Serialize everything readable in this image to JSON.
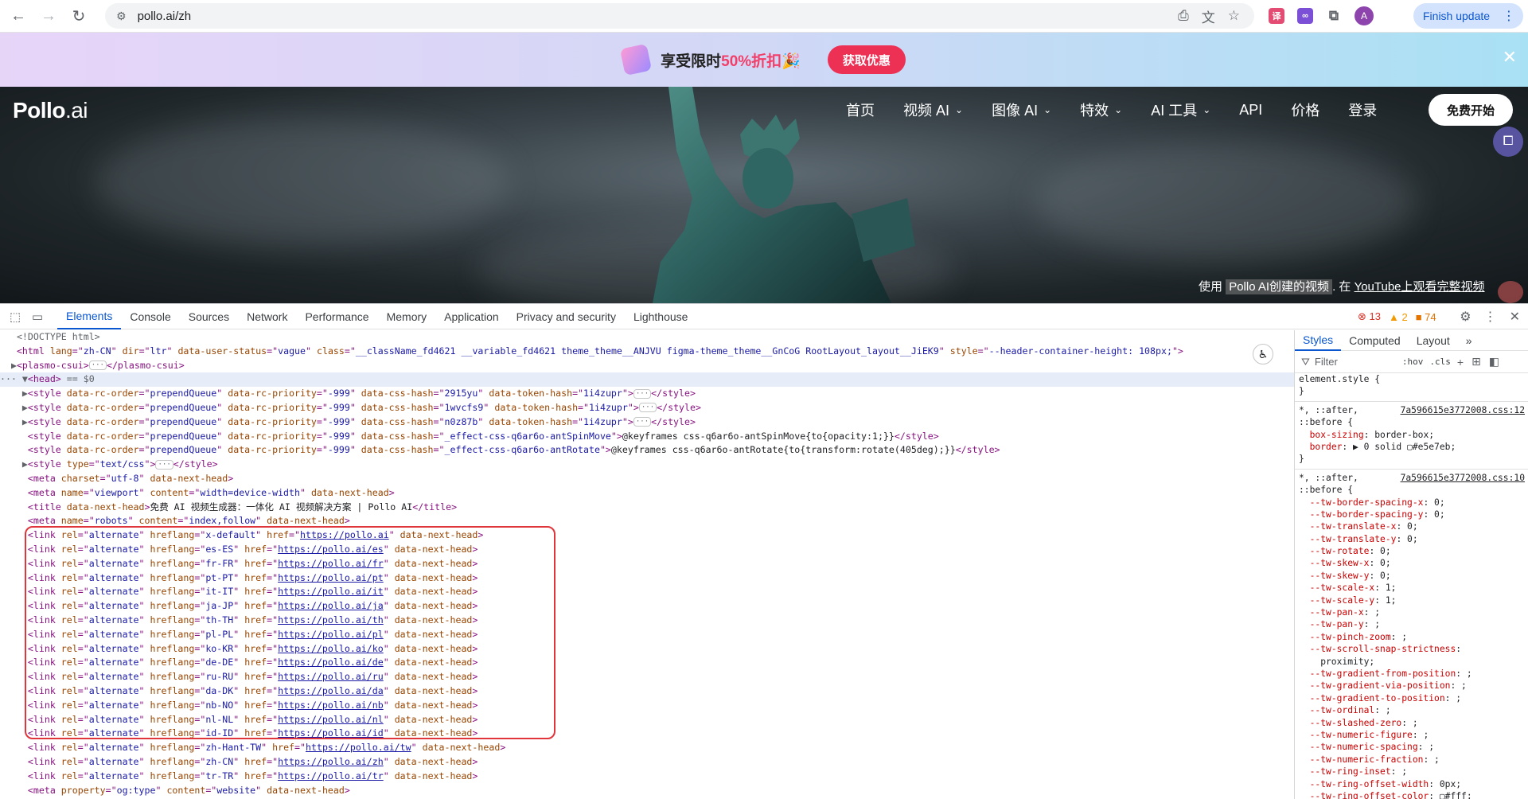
{
  "browser": {
    "url": "pollo.ai/zh",
    "finish_update": "Finish update",
    "avatar_letter": "A"
  },
  "promo": {
    "text_before": "享受限时",
    "text_pct": "50%折扣",
    "text_emoji": "🎉",
    "button": "获取优惠",
    "close": "✕"
  },
  "site": {
    "logo_main": "Pollo",
    "logo_suffix": ".ai",
    "nav": [
      {
        "label": "首页",
        "has_dropdown": false
      },
      {
        "label": "视频 AI",
        "has_dropdown": true
      },
      {
        "label": "图像 AI",
        "has_dropdown": true
      },
      {
        "label": "特效",
        "has_dropdown": true
      },
      {
        "label": "AI 工具",
        "has_dropdown": true
      },
      {
        "label": "API",
        "has_dropdown": false
      },
      {
        "label": "价格",
        "has_dropdown": false
      },
      {
        "label": "登录",
        "has_dropdown": false
      }
    ],
    "start_button": "免费开始",
    "yt_note_prefix": "使用",
    "yt_note_highlight": "Pollo AI创建的视频",
    "yt_note_mid": ". 在",
    "yt_note_link": "YouTube上观看完整视频"
  },
  "devtools": {
    "tabs": [
      "Elements",
      "Console",
      "Sources",
      "Network",
      "Performance",
      "Memory",
      "Application",
      "Privacy and security",
      "Lighthouse"
    ],
    "active_tab": "Elements",
    "errors": "13",
    "warnings": "2",
    "issues": "74",
    "dom_lines": [
      {
        "indent": 1,
        "arrow": "",
        "parts": [
          [
            "c",
            "<!DOCTYPE html>"
          ]
        ]
      },
      {
        "indent": 1,
        "arrow": "",
        "parts": [
          [
            "t",
            "<html "
          ],
          [
            "a",
            "lang"
          ],
          [
            "t",
            "=\""
          ],
          [
            "v",
            "zh-CN"
          ],
          [
            "t",
            "\" "
          ],
          [
            "a",
            "dir"
          ],
          [
            "t",
            "=\""
          ],
          [
            "v",
            "ltr"
          ],
          [
            "t",
            "\" "
          ],
          [
            "a",
            "data-user-status"
          ],
          [
            "t",
            "=\""
          ],
          [
            "v",
            "vague"
          ],
          [
            "t",
            "\" "
          ],
          [
            "a",
            "class"
          ],
          [
            "t",
            "=\""
          ],
          [
            "v",
            "__className_fd4621 __variable_fd4621 theme_theme__ANJVU figma-theme_theme__GnCoG RootLayout_layout__JiEK9"
          ],
          [
            "t",
            "\" "
          ],
          [
            "a",
            "style"
          ],
          [
            "t",
            "=\""
          ],
          [
            "v",
            "--header-container-height: 108px;"
          ],
          [
            "t",
            "\">"
          ]
        ]
      },
      {
        "indent": 1,
        "arrow": "▶",
        "parts": [
          [
            "t",
            "<plasmo-csui>"
          ],
          [
            "e",
            "…"
          ],
          [
            "t",
            "</plasmo-csui>"
          ]
        ]
      },
      {
        "indent": 0,
        "arrow": "▼",
        "sel": true,
        "prefix": "··· ",
        "parts": [
          [
            "t",
            "<head>"
          ],
          [
            "c",
            " == $0"
          ]
        ]
      },
      {
        "indent": 2,
        "arrow": "▶",
        "parts": [
          [
            "t",
            "<style "
          ],
          [
            "a",
            "data-rc-order"
          ],
          [
            "t",
            "=\""
          ],
          [
            "v",
            "prependQueue"
          ],
          [
            "t",
            "\" "
          ],
          [
            "a",
            "data-rc-priority"
          ],
          [
            "t",
            "=\""
          ],
          [
            "v",
            "-999"
          ],
          [
            "t",
            "\" "
          ],
          [
            "a",
            "data-css-hash"
          ],
          [
            "t",
            "=\""
          ],
          [
            "v",
            "2915yu"
          ],
          [
            "t",
            "\" "
          ],
          [
            "a",
            "data-token-hash"
          ],
          [
            "t",
            "=\""
          ],
          [
            "v",
            "1i4zupr"
          ],
          [
            "t",
            "\">"
          ],
          [
            "e",
            "…"
          ],
          [
            "t",
            "</style>"
          ]
        ]
      },
      {
        "indent": 2,
        "arrow": "▶",
        "parts": [
          [
            "t",
            "<style "
          ],
          [
            "a",
            "data-rc-order"
          ],
          [
            "t",
            "=\""
          ],
          [
            "v",
            "prependQueue"
          ],
          [
            "t",
            "\" "
          ],
          [
            "a",
            "data-rc-priority"
          ],
          [
            "t",
            "=\""
          ],
          [
            "v",
            "-999"
          ],
          [
            "t",
            "\" "
          ],
          [
            "a",
            "data-css-hash"
          ],
          [
            "t",
            "=\""
          ],
          [
            "v",
            "1wvcfs9"
          ],
          [
            "t",
            "\" "
          ],
          [
            "a",
            "data-token-hash"
          ],
          [
            "t",
            "=\""
          ],
          [
            "v",
            "1i4zupr"
          ],
          [
            "t",
            "\">"
          ],
          [
            "e",
            "…"
          ],
          [
            "t",
            "</style>"
          ]
        ]
      },
      {
        "indent": 2,
        "arrow": "▶",
        "parts": [
          [
            "t",
            "<style "
          ],
          [
            "a",
            "data-rc-order"
          ],
          [
            "t",
            "=\""
          ],
          [
            "v",
            "prependQueue"
          ],
          [
            "t",
            "\" "
          ],
          [
            "a",
            "data-rc-priority"
          ],
          [
            "t",
            "=\""
          ],
          [
            "v",
            "-999"
          ],
          [
            "t",
            "\" "
          ],
          [
            "a",
            "data-css-hash"
          ],
          [
            "t",
            "=\""
          ],
          [
            "v",
            "n0z87b"
          ],
          [
            "t",
            "\" "
          ],
          [
            "a",
            "data-token-hash"
          ],
          [
            "t",
            "=\""
          ],
          [
            "v",
            "1i4zupr"
          ],
          [
            "t",
            "\">"
          ],
          [
            "e",
            "…"
          ],
          [
            "t",
            "</style>"
          ]
        ]
      },
      {
        "indent": 2,
        "arrow": "",
        "parts": [
          [
            "t",
            "<style "
          ],
          [
            "a",
            "data-rc-order"
          ],
          [
            "t",
            "=\""
          ],
          [
            "v",
            "prependQueue"
          ],
          [
            "t",
            "\" "
          ],
          [
            "a",
            "data-rc-priority"
          ],
          [
            "t",
            "=\""
          ],
          [
            "v",
            "-999"
          ],
          [
            "t",
            "\" "
          ],
          [
            "a",
            "data-css-hash"
          ],
          [
            "t",
            "=\""
          ],
          [
            "v",
            "_effect-css-q6ar6o-antSpinMove"
          ],
          [
            "t",
            "\">"
          ],
          [
            "x",
            "@keyframes css-q6ar6o-antSpinMove{to{opacity:1;}}"
          ],
          [
            "t",
            "</style>"
          ]
        ]
      },
      {
        "indent": 2,
        "arrow": "",
        "parts": [
          [
            "t",
            "<style "
          ],
          [
            "a",
            "data-rc-order"
          ],
          [
            "t",
            "=\""
          ],
          [
            "v",
            "prependQueue"
          ],
          [
            "t",
            "\" "
          ],
          [
            "a",
            "data-rc-priority"
          ],
          [
            "t",
            "=\""
          ],
          [
            "v",
            "-999"
          ],
          [
            "t",
            "\" "
          ],
          [
            "a",
            "data-css-hash"
          ],
          [
            "t",
            "=\""
          ],
          [
            "v",
            "_effect-css-q6ar6o-antRotate"
          ],
          [
            "t",
            "\">"
          ],
          [
            "x",
            "@keyframes css-q6ar6o-antRotate{to{transform:rotate(405deg);}}"
          ],
          [
            "t",
            "</style>"
          ]
        ]
      },
      {
        "indent": 2,
        "arrow": "▶",
        "parts": [
          [
            "t",
            "<style "
          ],
          [
            "a",
            "type"
          ],
          [
            "t",
            "=\""
          ],
          [
            "v",
            "text/css"
          ],
          [
            "t",
            "\">"
          ],
          [
            "e",
            "…"
          ],
          [
            "t",
            "</style>"
          ]
        ]
      },
      {
        "indent": 2,
        "arrow": "",
        "parts": [
          [
            "t",
            "<meta "
          ],
          [
            "a",
            "charset"
          ],
          [
            "t",
            "=\""
          ],
          [
            "v",
            "utf-8"
          ],
          [
            "t",
            "\" "
          ],
          [
            "a",
            "data-next-head"
          ],
          [
            "t",
            ">"
          ]
        ]
      },
      {
        "indent": 2,
        "arrow": "",
        "parts": [
          [
            "t",
            "<meta "
          ],
          [
            "a",
            "name"
          ],
          [
            "t",
            "=\""
          ],
          [
            "v",
            "viewport"
          ],
          [
            "t",
            "\" "
          ],
          [
            "a",
            "content"
          ],
          [
            "t",
            "=\""
          ],
          [
            "v",
            "width=device-width"
          ],
          [
            "t",
            "\" "
          ],
          [
            "a",
            "data-next-head"
          ],
          [
            "t",
            ">"
          ]
        ]
      },
      {
        "indent": 2,
        "arrow": "",
        "parts": [
          [
            "t",
            "<title "
          ],
          [
            "a",
            "data-next-head"
          ],
          [
            "t",
            ">"
          ],
          [
            "x",
            "免费 AI 视频生成器：一体化 AI 视频解决方案 | Pollo AI"
          ],
          [
            "t",
            "</title>"
          ]
        ]
      },
      {
        "indent": 2,
        "arrow": "",
        "parts": [
          [
            "t",
            "<meta "
          ],
          [
            "a",
            "name"
          ],
          [
            "t",
            "=\""
          ],
          [
            "v",
            "robots"
          ],
          [
            "t",
            "\" "
          ],
          [
            "a",
            "content"
          ],
          [
            "t",
            "=\""
          ],
          [
            "v",
            "index,follow"
          ],
          [
            "t",
            "\" "
          ],
          [
            "a",
            "data-next-head"
          ],
          [
            "t",
            ">"
          ]
        ]
      },
      {
        "indent": 2,
        "arrow": "",
        "link": [
          "x-default",
          "https://pollo.ai"
        ]
      },
      {
        "indent": 2,
        "arrow": "",
        "link": [
          "es-ES",
          "https://pollo.ai/es"
        ]
      },
      {
        "indent": 2,
        "arrow": "",
        "link": [
          "fr-FR",
          "https://pollo.ai/fr"
        ]
      },
      {
        "indent": 2,
        "arrow": "",
        "link": [
          "pt-PT",
          "https://pollo.ai/pt"
        ]
      },
      {
        "indent": 2,
        "arrow": "",
        "link": [
          "it-IT",
          "https://pollo.ai/it"
        ]
      },
      {
        "indent": 2,
        "arrow": "",
        "link": [
          "ja-JP",
          "https://pollo.ai/ja"
        ]
      },
      {
        "indent": 2,
        "arrow": "",
        "link": [
          "th-TH",
          "https://pollo.ai/th"
        ]
      },
      {
        "indent": 2,
        "arrow": "",
        "link": [
          "pl-PL",
          "https://pollo.ai/pl"
        ]
      },
      {
        "indent": 2,
        "arrow": "",
        "link": [
          "ko-KR",
          "https://pollo.ai/ko"
        ]
      },
      {
        "indent": 2,
        "arrow": "",
        "link": [
          "de-DE",
          "https://pollo.ai/de"
        ]
      },
      {
        "indent": 2,
        "arrow": "",
        "link": [
          "ru-RU",
          "https://pollo.ai/ru"
        ]
      },
      {
        "indent": 2,
        "arrow": "",
        "link": [
          "da-DK",
          "https://pollo.ai/da"
        ]
      },
      {
        "indent": 2,
        "arrow": "",
        "link": [
          "nb-NO",
          "https://pollo.ai/nb"
        ]
      },
      {
        "indent": 2,
        "arrow": "",
        "link": [
          "nl-NL",
          "https://pollo.ai/nl"
        ]
      },
      {
        "indent": 2,
        "arrow": "",
        "link": [
          "id-ID",
          "https://pollo.ai/id"
        ]
      },
      {
        "indent": 2,
        "arrow": "",
        "link": [
          "zh-Hant-TW",
          "https://pollo.ai/tw"
        ]
      },
      {
        "indent": 2,
        "arrow": "",
        "link": [
          "zh-CN",
          "https://pollo.ai/zh"
        ]
      },
      {
        "indent": 2,
        "arrow": "",
        "link": [
          "tr-TR",
          "https://pollo.ai/tr"
        ]
      },
      {
        "indent": 2,
        "arrow": "",
        "parts": [
          [
            "t",
            "<meta "
          ],
          [
            "a",
            "property"
          ],
          [
            "t",
            "=\""
          ],
          [
            "v",
            "og:type"
          ],
          [
            "t",
            "\" "
          ],
          [
            "a",
            "content"
          ],
          [
            "t",
            "=\""
          ],
          [
            "v",
            "website"
          ],
          [
            "t",
            "\" "
          ],
          [
            "a",
            "data-next-head"
          ],
          [
            "t",
            ">"
          ]
        ]
      }
    ],
    "styles_tabs": [
      "Styles",
      "Computed",
      "Layout"
    ],
    "filter_placeholder": "Filter",
    "hov": ":hov",
    "cls": ".cls",
    "rules": [
      {
        "selector": "element.style {",
        "source": "",
        "props": [],
        "close": "}"
      },
      {
        "selector": "*, ::after,",
        "selector2": "::before {",
        "source": "7a596615e3772008.css:12",
        "props": [
          [
            "box-sizing",
            "border-box;"
          ],
          [
            "border",
            "▶ 0 solid ▢#e5e7eb;"
          ]
        ],
        "close": "}"
      },
      {
        "selector": "*, ::after,",
        "selector2": "::before {",
        "source": "7a596615e3772008.css:10",
        "props": [
          [
            "--tw-border-spacing-x",
            "0;"
          ],
          [
            "--tw-border-spacing-y",
            "0;"
          ],
          [
            "--tw-translate-x",
            "0;"
          ],
          [
            "--tw-translate-y",
            "0;"
          ],
          [
            "--tw-rotate",
            "0;"
          ],
          [
            "--tw-skew-x",
            "0;"
          ],
          [
            "--tw-skew-y",
            "0;"
          ],
          [
            "--tw-scale-x",
            "1;"
          ],
          [
            "--tw-scale-y",
            "1;"
          ],
          [
            "--tw-pan-x",
            ";"
          ],
          [
            "--tw-pan-y",
            ";"
          ],
          [
            "--tw-pinch-zoom",
            ";"
          ],
          [
            "--tw-scroll-snap-strictness",
            ""
          ],
          [
            "",
            "    proximity;"
          ],
          [
            "--tw-gradient-from-position",
            ";"
          ],
          [
            "--tw-gradient-via-position",
            ";"
          ],
          [
            "--tw-gradient-to-position",
            ";"
          ],
          [
            "--tw-ordinal",
            ";"
          ],
          [
            "--tw-slashed-zero",
            ";"
          ],
          [
            "--tw-numeric-figure",
            ";"
          ],
          [
            "--tw-numeric-spacing",
            ";"
          ],
          [
            "--tw-numeric-fraction",
            ";"
          ],
          [
            "--tw-ring-inset",
            ";"
          ],
          [
            "--tw-ring-offset-width",
            "0px;"
          ],
          [
            "--tw-ring-offset-color",
            "▢#fff;"
          ]
        ],
        "close": ""
      }
    ]
  }
}
